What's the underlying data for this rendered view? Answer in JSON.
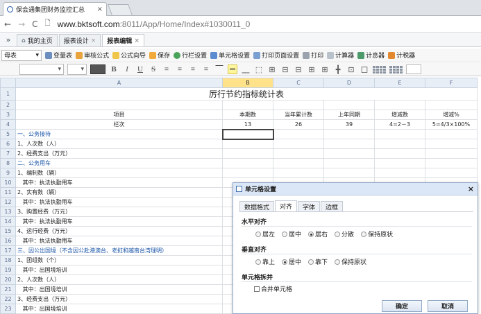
{
  "browser": {
    "tab_title": "保会通集团财务监控汇总",
    "url_host": "www.bktsoft.com",
    "url_rest": ":8011/App/Home/Index#1030011_0"
  },
  "app_tabs": [
    {
      "label": "我的主页"
    },
    {
      "label": "报表设计",
      "close": "×"
    },
    {
      "label": "报表编辑",
      "close": "×"
    }
  ],
  "toolbar1": {
    "template_select": "母表",
    "items": [
      "变量表",
      "审核公式",
      "公式向导",
      "保存",
      "行栏设置",
      "单元格设置",
      "打印页面设置",
      "打印",
      "计算器",
      "计息器",
      "计税器"
    ]
  },
  "toolbar2": {
    "font_select": "",
    "size_select": "",
    "bold": "B",
    "italic": "I",
    "underline": "U",
    "strike": "S"
  },
  "sheet": {
    "columns": [
      "A",
      "B",
      "C",
      "D",
      "E",
      "F"
    ],
    "title": "厉行节约指标统计表",
    "header_row": [
      "项目",
      "本期数",
      "当年累计数",
      "上年同期",
      "增减数",
      "增减%"
    ],
    "index_row": [
      "栏次",
      "13",
      "26",
      "39",
      "4=2－3",
      "5=4/3×100%"
    ],
    "rows": [
      {
        "num": "5",
        "text": "一、公务接待",
        "blue": true
      },
      {
        "num": "6",
        "text": "1、人次数（人）"
      },
      {
        "num": "7",
        "text": "2、经费支出（万元）"
      },
      {
        "num": "8",
        "text": "二、公务用车",
        "blue": true
      },
      {
        "num": "9",
        "text": "1、编制数（辆）"
      },
      {
        "num": "10",
        "text": "   其中：执法执勤用车"
      },
      {
        "num": "11",
        "text": "2、实有数（辆）"
      },
      {
        "num": "12",
        "text": "   其中：执法执勤用车"
      },
      {
        "num": "13",
        "text": "3、购置经费（万元）"
      },
      {
        "num": "14",
        "text": "   其中：执法执勤用车"
      },
      {
        "num": "15",
        "text": "4、运行经费（万元）"
      },
      {
        "num": "16",
        "text": "   其中：执法执勤用车"
      },
      {
        "num": "17",
        "text": "三、因公出国境（不含因公赴港澳台、老挝和越南台湾理明）",
        "blue": true
      },
      {
        "num": "18",
        "text": "1、团组数（个）"
      },
      {
        "num": "19",
        "text": "   其中：出国境培训"
      },
      {
        "num": "20",
        "text": "2、人次数（人）"
      },
      {
        "num": "21",
        "text": "   其中：出国境培训"
      },
      {
        "num": "22",
        "text": "3、经费支出（万元）"
      },
      {
        "num": "23",
        "text": "   其中：出国境培训"
      }
    ]
  },
  "dialog": {
    "title": "单元格设置",
    "tabs": [
      "数据格式",
      "对齐",
      "字体",
      "边框"
    ],
    "h_align_label": "水平对齐",
    "h_align_options": [
      "居左",
      "居中",
      "居右",
      "分散",
      "保持原状"
    ],
    "h_align_selected": "居右",
    "v_align_label": "垂直对齐",
    "v_align_options": [
      "靠上",
      "居中",
      "靠下",
      "保持原状"
    ],
    "v_align_selected": "居中",
    "split_label": "单元格拆并",
    "merge_label": "合并单元格",
    "ok": "确定",
    "cancel": "取消",
    "close": "×"
  },
  "colors": {
    "accent": "#1a55a8",
    "selected_column": "#ffe28a",
    "row_header": "#e8eef6"
  }
}
